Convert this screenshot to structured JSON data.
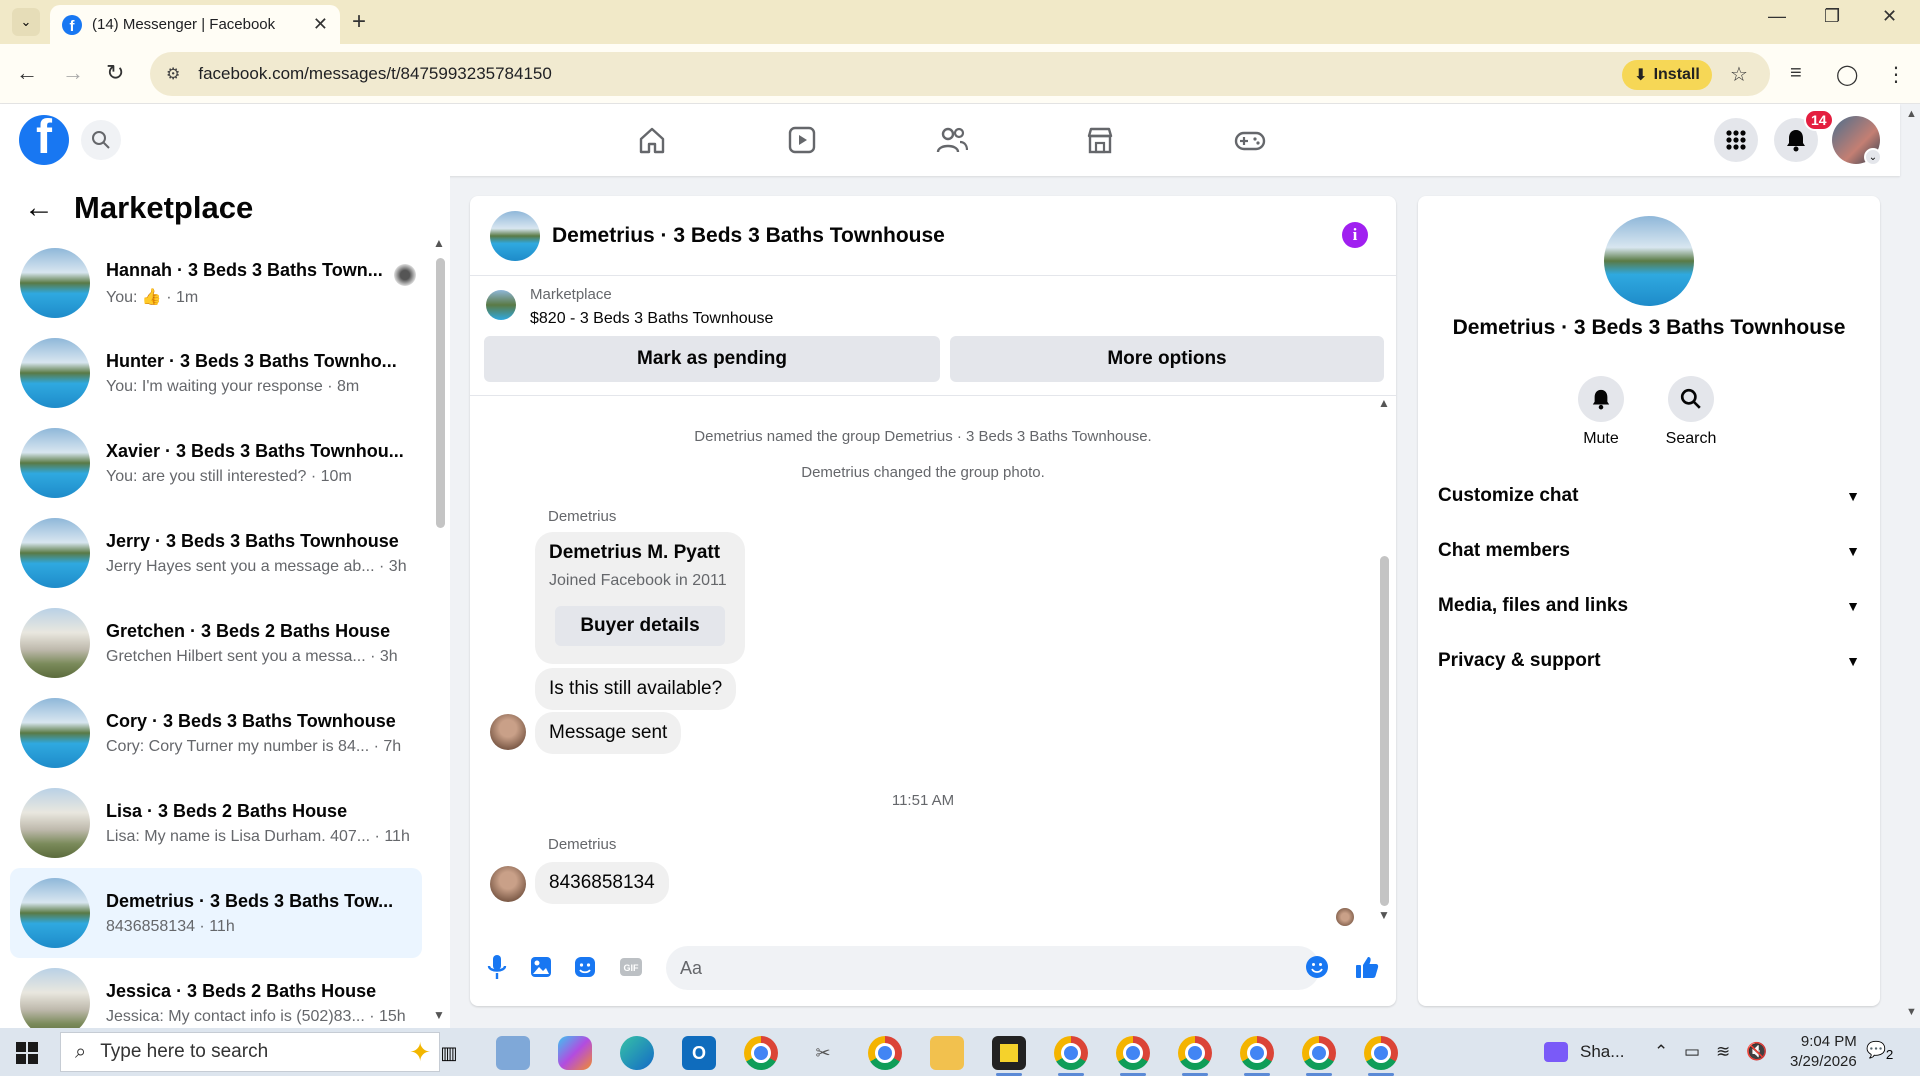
{
  "browser": {
    "tab_title": "(14) Messenger | Facebook",
    "url": "facebook.com/messages/t/8475993235784150",
    "install_label": "Install"
  },
  "fb_header": {
    "notification_count": "14",
    "nav_icons": [
      "home-icon",
      "video-icon",
      "friends-icon",
      "marketplace-icon",
      "gaming-icon"
    ]
  },
  "sidebar": {
    "title": "Marketplace",
    "conversations": [
      {
        "name": "Hannah · 3 Beds 3 Baths Town...",
        "snippet": "You: 👍 · 1m",
        "thumb": "pool",
        "active": false
      },
      {
        "name": "Hunter · 3 Beds 3 Baths Townho...",
        "snippet": "You: I'm waiting your response · 8m",
        "thumb": "pool",
        "active": false
      },
      {
        "name": "Xavier · 3 Beds 3 Baths Townhou...",
        "snippet": "You: are you still interested? · 10m",
        "thumb": "pool",
        "active": false
      },
      {
        "name": "Jerry · 3 Beds 3 Baths Townhouse",
        "snippet": "Jerry Hayes sent you a message ab... · 3h",
        "thumb": "pool",
        "active": false
      },
      {
        "name": "Gretchen · 3 Beds 2 Baths House",
        "snippet": "Gretchen Hilbert sent you a messa... · 3h",
        "thumb": "house",
        "active": false
      },
      {
        "name": "Cory · 3 Beds 3 Baths Townhouse",
        "snippet": "Cory: Cory Turner my number is 84... · 7h",
        "thumb": "pool",
        "active": false
      },
      {
        "name": "Lisa · 3 Beds 2 Baths House",
        "snippet": "Lisa: My name is Lisa Durham. 407... · 11h",
        "thumb": "house",
        "active": false
      },
      {
        "name": "Demetrius · 3 Beds 3 Baths Tow...",
        "snippet": "8436858134 · 11h",
        "thumb": "pool",
        "active": true
      },
      {
        "name": "Jessica · 3 Beds 2 Baths House",
        "snippet": "Jessica: My contact info is (502)83... · 15h",
        "thumb": "house",
        "active": false
      }
    ]
  },
  "chat": {
    "title": "Demetrius · 3 Beds 3 Baths Townhouse",
    "listing_source": "Marketplace",
    "listing_price": "$820 - 3 Beds 3 Baths Townhouse",
    "mark_pending_label": "Mark as pending",
    "more_options_label": "More options",
    "system_1": "Demetrius named the group Demetrius · 3 Beds 3 Baths Townhouse.",
    "system_2": "Demetrius changed the group photo.",
    "sender_1": "Demetrius",
    "card_name": "Demetrius M. Pyatt",
    "card_joined": "Joined Facebook in 2011",
    "buyer_details_label": "Buyer details",
    "msg_1": "Is this still available?",
    "msg_2": "Message sent",
    "timestamp": "11:51 AM",
    "sender_2": "Demetrius",
    "msg_3": "8436858134",
    "composer_placeholder": "Aa"
  },
  "info_panel": {
    "name": "Demetrius · 3 Beds 3 Baths Townhouse",
    "mute_label": "Mute",
    "search_label": "Search",
    "sections": [
      "Customize chat",
      "Chat members",
      "Media, files and links",
      "Privacy & support"
    ]
  },
  "taskbar": {
    "search_placeholder": "Type here to search",
    "tray_app": "Sha...",
    "time": "9:04 PM",
    "date": "3/29/2026",
    "notification_count": "2"
  },
  "colors": {
    "fb_blue": "#1877f2",
    "badge_red": "#e41e3f",
    "active_conv": "#ebf5ff",
    "info_purple": "#a020f0"
  }
}
